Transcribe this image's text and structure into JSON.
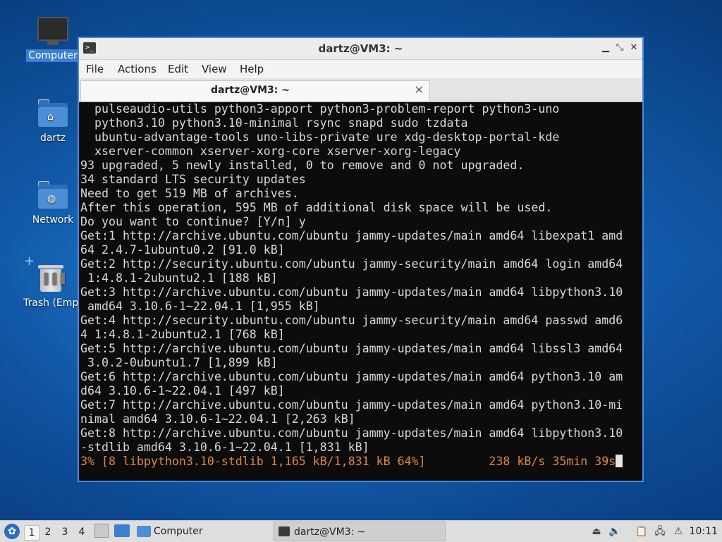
{
  "desktop": {
    "icons": [
      {
        "label": "Computer",
        "selected": true
      },
      {
        "label": "dartz"
      },
      {
        "label": "Network"
      },
      {
        "label": "Trash (Empt"
      }
    ]
  },
  "window": {
    "title": "dartz@VM3: ~",
    "menu": [
      "File",
      "Actions",
      "Edit",
      "View",
      "Help"
    ],
    "tab_title": "dartz@VM3: ~",
    "tab_close": "✕",
    "controls": {
      "minimize": "▁",
      "maximize": "⤡",
      "close": "✕"
    }
  },
  "terminal": {
    "lines": [
      "  pulseaudio-utils python3-apport python3-problem-report python3-uno",
      "  python3.10 python3.10-minimal rsync snapd sudo tzdata",
      "  ubuntu-advantage-tools uno-libs-private ure xdg-desktop-portal-kde",
      "  xserver-common xserver-xorg-core xserver-xorg-legacy",
      "93 upgraded, 5 newly installed, 0 to remove and 0 not upgraded.",
      "34 standard LTS security updates",
      "Need to get 519 MB of archives.",
      "After this operation, 595 MB of additional disk space will be used.",
      "Do you want to continue? [Y/n] y",
      "Get:1 http://archive.ubuntu.com/ubuntu jammy-updates/main amd64 libexpat1 amd",
      "64 2.4.7-1ubuntu0.2 [91.0 kB]",
      "Get:2 http://security.ubuntu.com/ubuntu jammy-security/main amd64 login amd64",
      " 1:4.8.1-2ubuntu2.1 [188 kB]",
      "Get:3 http://archive.ubuntu.com/ubuntu jammy-updates/main amd64 libpython3.10",
      " amd64 3.10.6-1~22.04.1 [1,955 kB]",
      "Get:4 http://security.ubuntu.com/ubuntu jammy-security/main amd64 passwd amd6",
      "4 1:4.8.1-2ubuntu2.1 [768 kB]",
      "Get:5 http://archive.ubuntu.com/ubuntu jammy-updates/main amd64 libssl3 amd64",
      " 3.0.2-0ubuntu1.7 [1,899 kB]",
      "Get:6 http://archive.ubuntu.com/ubuntu jammy-updates/main amd64 python3.10 am",
      "d64 3.10.6-1~22.04.1 [497 kB]",
      "Get:7 http://archive.ubuntu.com/ubuntu jammy-updates/main amd64 python3.10-mi",
      "nimal amd64 3.10.6-1~22.04.1 [2,263 kB]",
      "Get:8 http://archive.ubuntu.com/ubuntu jammy-updates/main amd64 libpython3.10",
      "-stdlib amd64 3.10.6-1~22.04.1 [1,831 kB]"
    ],
    "progress_line": "3% [8 libpython3.10-stdlib 1,165 kB/1,831 kB 64%]         238 kB/s 35min 39s",
    "progress_color": "#e0873c"
  },
  "taskbar": {
    "workspaces": [
      "1",
      "2",
      "3",
      "4"
    ],
    "active_workspace": "1",
    "windows": [
      {
        "label": "Computer",
        "icon": "folder-icon"
      },
      {
        "label": "dartz@VM3: ~",
        "icon": "terminal-icon",
        "active": true
      }
    ],
    "tray_icons": [
      "caps-icon",
      "volume-icon",
      "clipboard-icon",
      "network-icon",
      "update-icon"
    ],
    "clock": "10:11"
  }
}
